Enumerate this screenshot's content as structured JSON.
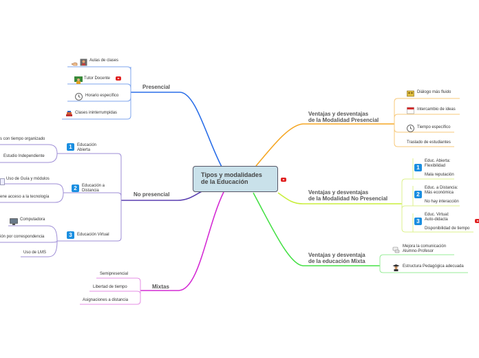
{
  "central": {
    "title_l1": "Tipos y modalidades",
    "title_l2": "de la Educación"
  },
  "presencial": {
    "label": "Presencial",
    "items": [
      "Aulas de clases",
      "Tutor Docente",
      "Horario específico",
      "Clases ininterrumpidas"
    ]
  },
  "no_presencial": {
    "label": "No presencial",
    "groups": [
      {
        "num": "1",
        "label_l1": "Educación",
        "label_l2": "Abierta",
        "items": [
          "s con tiempo organizado",
          "Estudio Independiente"
        ]
      },
      {
        "num": "2",
        "label_l1": "Educación a",
        "label_l2": "Distancia",
        "items": [
          "Uso de Guía y módulos",
          "ene acceso a la tecnología"
        ]
      },
      {
        "num": "3",
        "label_l1": "Educación Virtual",
        "label_l2": "",
        "items": [
          "Computadora",
          "ión por correspondencia",
          "Uso de LMS"
        ]
      }
    ]
  },
  "mixtas": {
    "label": "Mixtas",
    "items": [
      "Semipresencial",
      "Libertad de tiempo",
      "Asignaciones a distancia"
    ]
  },
  "ventajas_presencial": {
    "label_l1": "Ventajas y desventajas",
    "label_l2": "de la Modalidad  Presencial",
    "items": [
      "Diálogo más fluido",
      "Intercambio de ideas",
      "Tiempo específico",
      "Traslado de estudiantes"
    ]
  },
  "ventajas_no_presencial": {
    "label_l1": "Ventajas y desventajas",
    "label_l2": "de la Modalidad No Presencial",
    "groups": [
      {
        "num": "1",
        "l1": "Educ. Abierta:",
        "l2": "Flexibilidad",
        "l3": "Mala reputación"
      },
      {
        "num": "2",
        "l1": "Educ. a Distancia:",
        "l2": "Más económica",
        "l3": "No hay interacción"
      },
      {
        "num": "3",
        "l1": "Educ. Virtual:",
        "l2": "Auto-didacta",
        "l3": "Disponibilidad de tiempo"
      }
    ]
  },
  "ventajas_mixta": {
    "label_l1": "Ventajas y desventaja",
    "label_l2": "de la educación Mixta",
    "items": [
      {
        "l1": "Mejora la comunicación",
        "l2": "Alumno-Profesor"
      },
      {
        "l1": "Estructura Pedagógica adecuada",
        "l2": ""
      }
    ]
  },
  "colors": {
    "presencial": "#2a6ee8",
    "no_presencial": "#5a3fb0",
    "mixtas": "#d42ad4",
    "ventajas_presencial": "#f5a623",
    "ventajas_no_presencial": "#c8ee3a",
    "ventajas_mixta": "#45e045",
    "leaf_presencial": "#7fa6ee",
    "leaf_no_presencial": "#9d8cd6",
    "leaf_mixtas": "#e48de4",
    "leaf_vp": "#f7c87a",
    "leaf_vnp": "#dcf28c",
    "leaf_vm": "#97ec97"
  }
}
